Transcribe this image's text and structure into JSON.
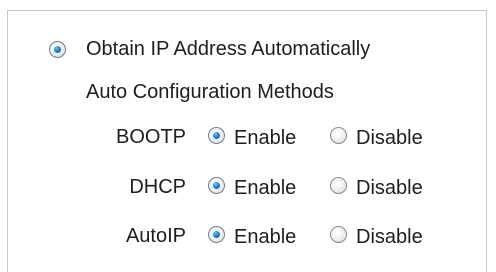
{
  "ip_mode": {
    "label": "Obtain IP Address Automatically",
    "selected": true
  },
  "auto_config": {
    "heading": "Auto Configuration Methods"
  },
  "methods": [
    {
      "name": "BOOTP",
      "selected": "Enable"
    },
    {
      "name": "DHCP",
      "selected": "Enable"
    },
    {
      "name": "AutoIP",
      "selected": "Enable"
    }
  ],
  "options": {
    "enable": "Enable",
    "disable": "Disable"
  }
}
